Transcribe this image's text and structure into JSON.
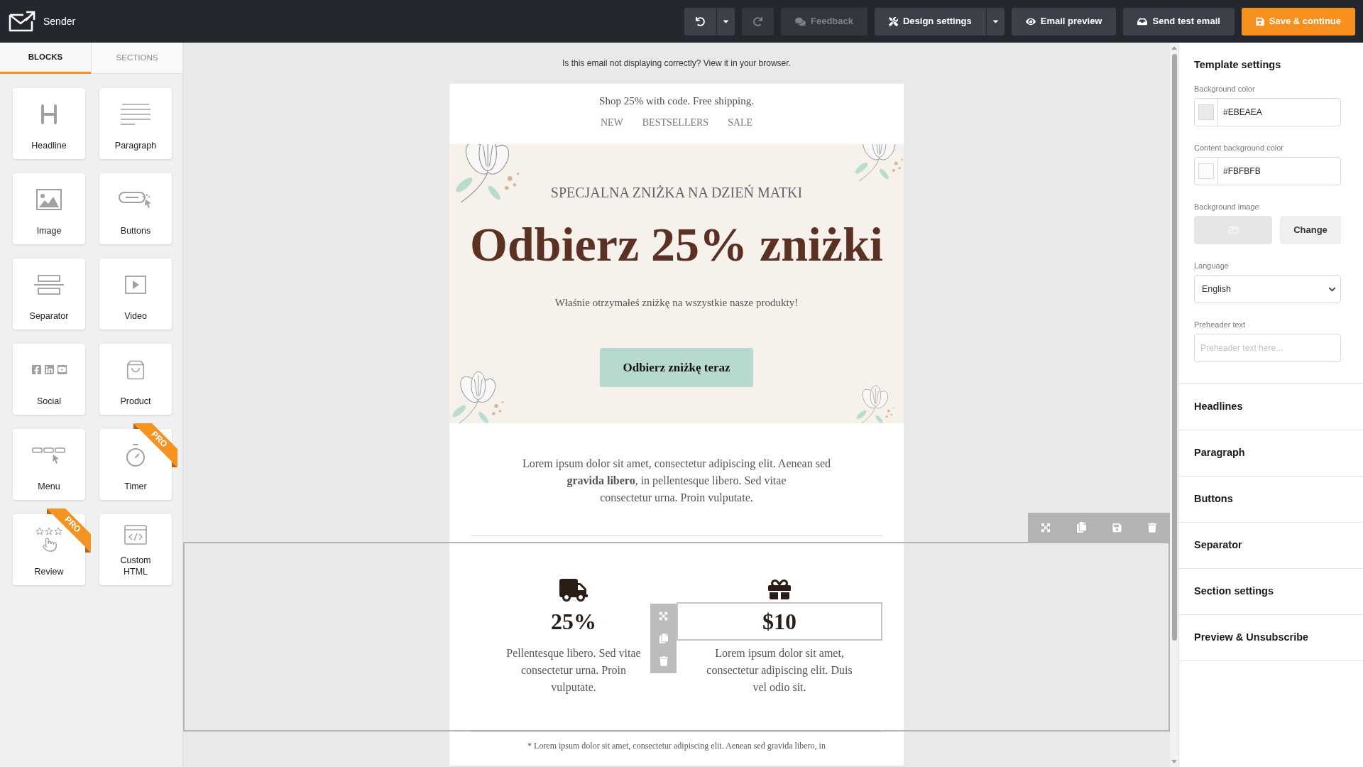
{
  "top_bar": {
    "brand": "Sender",
    "groups": [
      {
        "buttons": [
          {
            "kind": "undo",
            "disabled": false
          },
          {
            "kind": "dropdown",
            "disabled": false
          }
        ]
      },
      {
        "buttons": [
          {
            "kind": "redo",
            "disabled": true
          }
        ]
      },
      {
        "buttons": [
          {
            "kind": "feedback",
            "label": "Feedback",
            "disabled": true
          }
        ]
      },
      {
        "buttons": [
          {
            "kind": "design",
            "label": "Design settings",
            "disabled": false
          },
          {
            "kind": "dropdown",
            "disabled": false
          }
        ]
      },
      {
        "buttons": [
          {
            "kind": "preview",
            "label": "Email preview",
            "disabled": false
          }
        ]
      },
      {
        "buttons": [
          {
            "kind": "test",
            "label": "Send test email",
            "disabled": false
          }
        ]
      },
      {
        "buttons": [
          {
            "kind": "save",
            "label": "Save & continue",
            "disabled": false
          }
        ]
      }
    ]
  },
  "sidebar": {
    "tabs": [
      {
        "label": "BLOCKS",
        "selected": true
      },
      {
        "label": "SECTIONS",
        "selected": false
      }
    ],
    "blocks": [
      {
        "kind": "headline",
        "label": "Headline"
      },
      {
        "kind": "paragraph",
        "label": "Paragraph"
      },
      {
        "kind": "image",
        "label": "Image"
      },
      {
        "kind": "buttons",
        "label": "Buttons"
      },
      {
        "kind": "separator",
        "label": "Separator"
      },
      {
        "kind": "video",
        "label": "Video"
      },
      {
        "kind": "social",
        "label": "Social"
      },
      {
        "kind": "product",
        "label": "Product"
      },
      {
        "kind": "menu",
        "label": "Menu"
      },
      {
        "kind": "timer",
        "label": "Timer",
        "ribbon": "PRO"
      },
      {
        "kind": "review",
        "label": "Review",
        "ribbon": "PRO"
      },
      {
        "kind": "html",
        "label": "Custom HTML"
      }
    ]
  },
  "canvas": {
    "browser_notice": "Is this email not displaying correctly? View it in your browser.",
    "sections": [
      {
        "kind": "header",
        "selected": false,
        "text": "Shop 25% with code. Free shipping.",
        "links": [
          "NEW",
          "BESTSELLERS",
          "SALE"
        ]
      },
      {
        "kind": "hero",
        "selected": false,
        "eyebrow": "SPECJALNA ZNIŻKA NA DZIEŃ MATKI",
        "headline": "Odbierz 25% zniżki",
        "subtext": "Właśnie otrzymałeś zniżkę na wszystkie nasze produkty!",
        "button": "Odbierz zniżkę teraz"
      },
      {
        "kind": "text",
        "selected": false,
        "text": "Lorem ipsum dolor sit amet, consectetur adipiscing elit. Aenean sed\n**gravida libero**, in pellentesque libero. Sed vitae\nconsectetur urna. Proin vulputate."
      },
      {
        "kind": "columns",
        "selected": true,
        "columns": [
          {
            "value": "25%",
            "text": "Pellentesque libero. Sed vitae consectetur urna. Proin vulputate.",
            "selected": false
          },
          {
            "value": "$10",
            "text": "Lorem ipsum dolor sit amet, consectetur adipiscing elit. Duis vel odio sit.",
            "selected": true
          }
        ]
      },
      {
        "kind": "footnote",
        "selected": false,
        "text": "* Lorem ipsum dolor sit amet, consectetur adipiscing elit. Aenean sed gravida libero, in"
      }
    ]
  },
  "settings": {
    "title": "Template settings",
    "fields": [
      {
        "kind": "color",
        "label": "Background color",
        "value": "#EBEAEA",
        "color": "#ebeaea"
      },
      {
        "kind": "color",
        "label": "Content background color",
        "value": "#FBFBFB",
        "color": "#fbfbfb"
      },
      {
        "kind": "image",
        "label": "Background image",
        "button": "Change"
      },
      {
        "kind": "select",
        "label": "Language",
        "value": "English"
      },
      {
        "kind": "text",
        "label": "Preheader text",
        "placeholder": "Preheader text here..."
      }
    ]
  },
  "panels": [
    "Headlines",
    "Paragraph",
    "Buttons",
    "Separator",
    "Section settings",
    "Preview & Unsubscribe"
  ]
}
